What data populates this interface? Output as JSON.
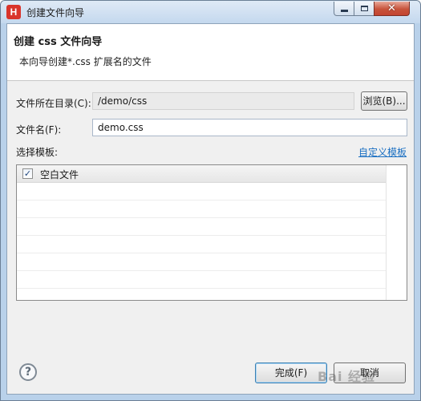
{
  "window": {
    "title": "创建文件向导",
    "icon_letter": "H",
    "minimize_symbol": "",
    "close_symbol": "✕"
  },
  "banner": {
    "title": "创建 css 文件向导",
    "description": "本向导创建*.css 扩展名的文件"
  },
  "form": {
    "directory_label": "文件所在目录(C):",
    "directory_value": "/demo/css",
    "browse_label": "浏览(B)...",
    "filename_label": "文件名(F):",
    "filename_value": "demo.css",
    "template_label": "选择模板:",
    "custom_template_link": "自定义模板"
  },
  "templates": [
    {
      "name": "空白文件",
      "checked": true,
      "check_mark": "✓"
    }
  ],
  "footer": {
    "help_symbol": "?",
    "finish_label": "完成(F)",
    "cancel_label": "取消"
  },
  "watermark": {
    "text": "Bai 经验"
  },
  "colors": {
    "accent_link": "#1a6fc2",
    "close_button": "#c7533b",
    "app_icon": "#d9342b"
  }
}
